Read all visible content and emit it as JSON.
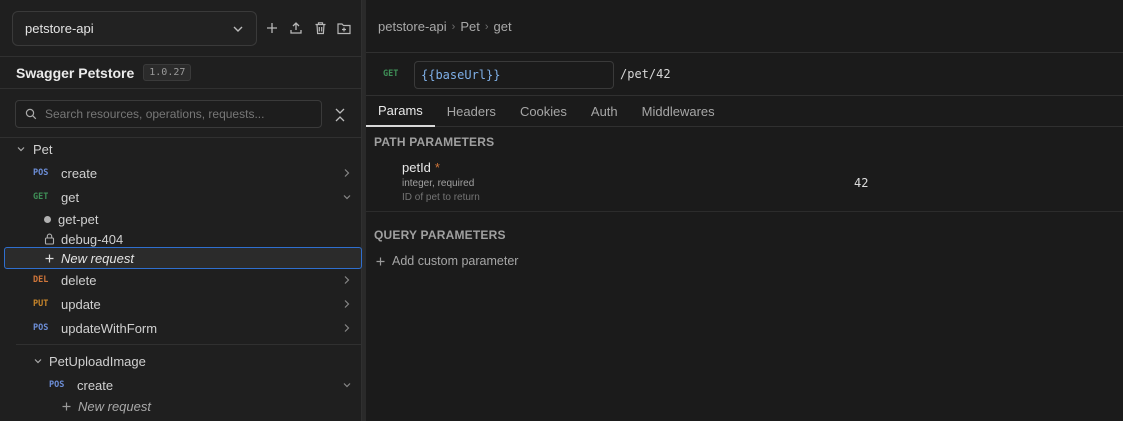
{
  "project": {
    "name": "petstore-api"
  },
  "app": {
    "title": "Swagger Petstore",
    "version": "1.0.27"
  },
  "search": {
    "placeholder": "Search resources, operations, requests..."
  },
  "tree": {
    "pet_group": {
      "label": "Pet"
    },
    "pet_items": [
      {
        "method": "POS",
        "label": "create"
      },
      {
        "method": "GET",
        "label": "get"
      },
      {
        "method": "DEL",
        "label": "delete"
      },
      {
        "method": "PUT",
        "label": "update"
      },
      {
        "method": "POS",
        "label": "updateWithForm"
      }
    ],
    "get_children": [
      {
        "label": "get-pet"
      },
      {
        "label": "debug-404"
      },
      {
        "label": "New request"
      }
    ],
    "upload_group": {
      "label": "PetUploadImage"
    },
    "upload_items": [
      {
        "method": "POS",
        "label": "create"
      }
    ],
    "upload_children": [
      {
        "label": "New request"
      }
    ]
  },
  "breadcrumb": [
    "petstore-api",
    "Pet",
    "get"
  ],
  "request": {
    "method": "GET",
    "base_url": "{{baseUrl}}",
    "path": "/pet/42"
  },
  "tabs": [
    "Params",
    "Headers",
    "Cookies",
    "Auth",
    "Middlewares"
  ],
  "path_params": {
    "title": "PATH PARAMETERS",
    "items": [
      {
        "name": "petId",
        "required_mark": "*",
        "type": "integer, required",
        "description": "ID of pet to return",
        "value": "42"
      }
    ]
  },
  "query_params": {
    "title": "QUERY PARAMETERS",
    "add_label": "Add custom parameter"
  },
  "colors": {
    "accent": "#2f6fcf",
    "get": "#3f8f57",
    "post": "#6d8fd9",
    "delete": "#d0763a",
    "put": "#c9862a"
  }
}
